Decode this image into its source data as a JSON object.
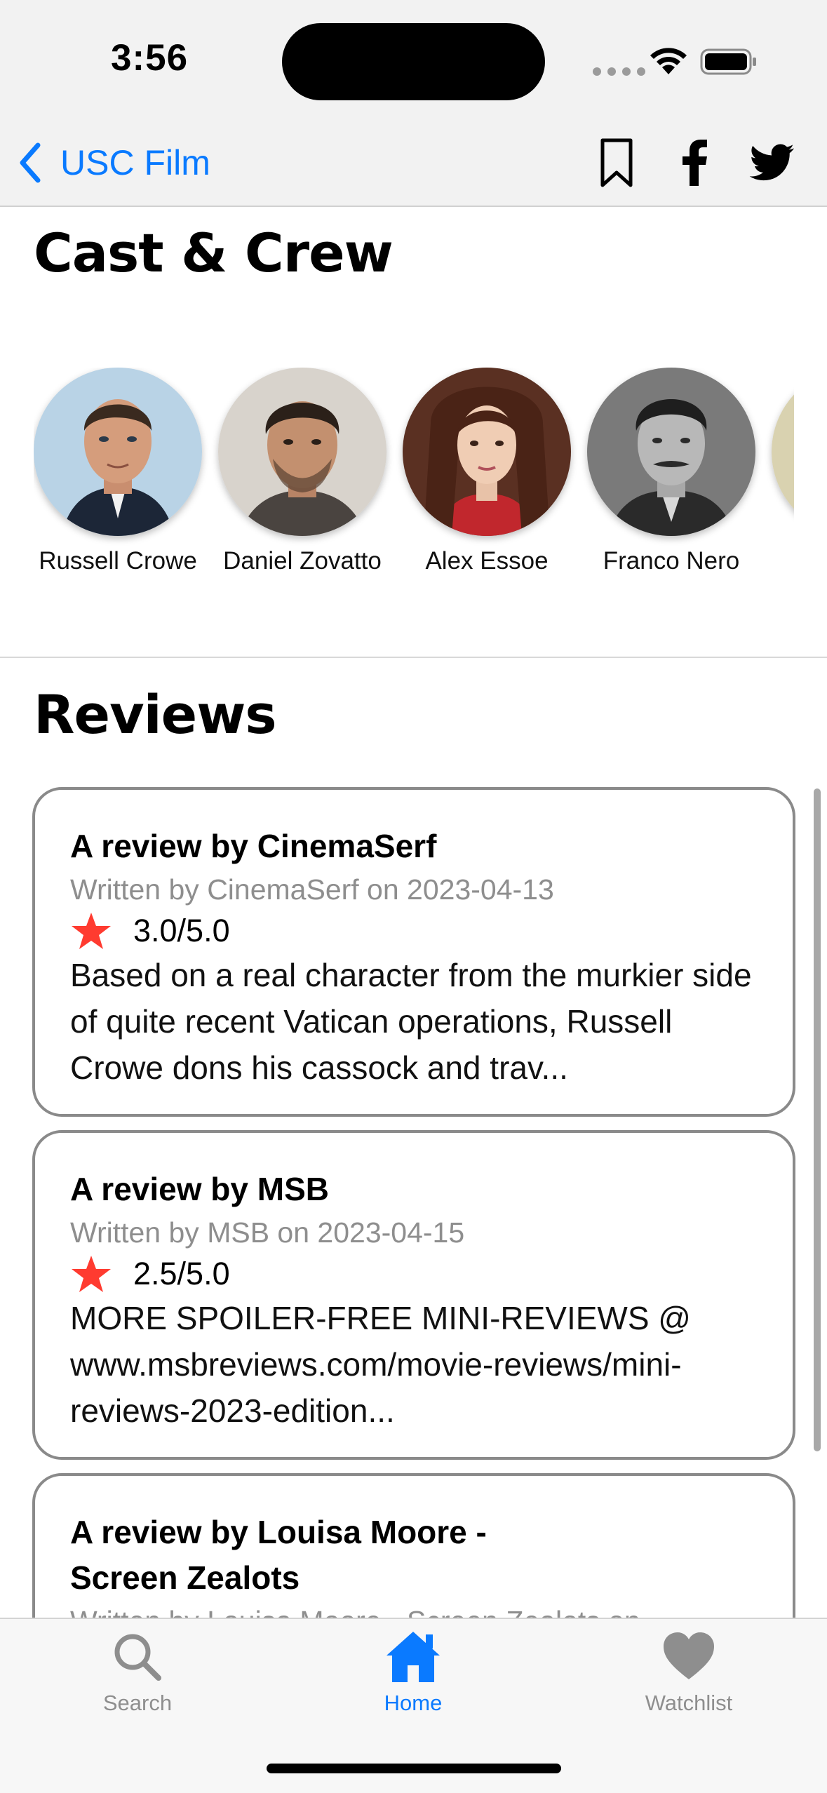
{
  "status_bar": {
    "time": "3:56"
  },
  "nav": {
    "back_label": "USC Film"
  },
  "cast": {
    "title": "Cast & Crew",
    "members": [
      {
        "name": "Russell Crowe"
      },
      {
        "name": "Daniel Zovatto"
      },
      {
        "name": "Alex Essoe"
      },
      {
        "name": "Franco Nero"
      }
    ]
  },
  "reviews": {
    "title": "Reviews",
    "items": [
      {
        "title": "A review by CinemaSerf",
        "meta": "Written by CinemaSerf on 2023-04-13",
        "rating": "3.0/5.0",
        "body": "Based on a real character from the murkier side of quite recent Vatican operations, Russell Crowe dons his cassock and trav..."
      },
      {
        "title": "A review by MSB",
        "meta": "Written by MSB on 2023-04-15",
        "rating": "2.5/5.0",
        "body": "MORE SPOILER-FREE MINI-REVIEWS @ www.msbreviews.com/movie-reviews/mini-reviews-2023-edition..."
      },
      {
        "title": "A review by Louisa Moore - Screen Zealots",
        "meta": "Written by Louisa Moore - Screen Zealots on",
        "rating": "",
        "body": ""
      }
    ]
  },
  "tabs": [
    {
      "label": "Search",
      "icon": "search-icon",
      "active": false
    },
    {
      "label": "Home",
      "icon": "home-icon",
      "active": true
    },
    {
      "label": "Watchlist",
      "icon": "heart-icon",
      "active": false
    }
  ],
  "colors": {
    "accent": "#0a7aff",
    "star": "#ff3b30",
    "inactive": "#8e8e8e"
  }
}
